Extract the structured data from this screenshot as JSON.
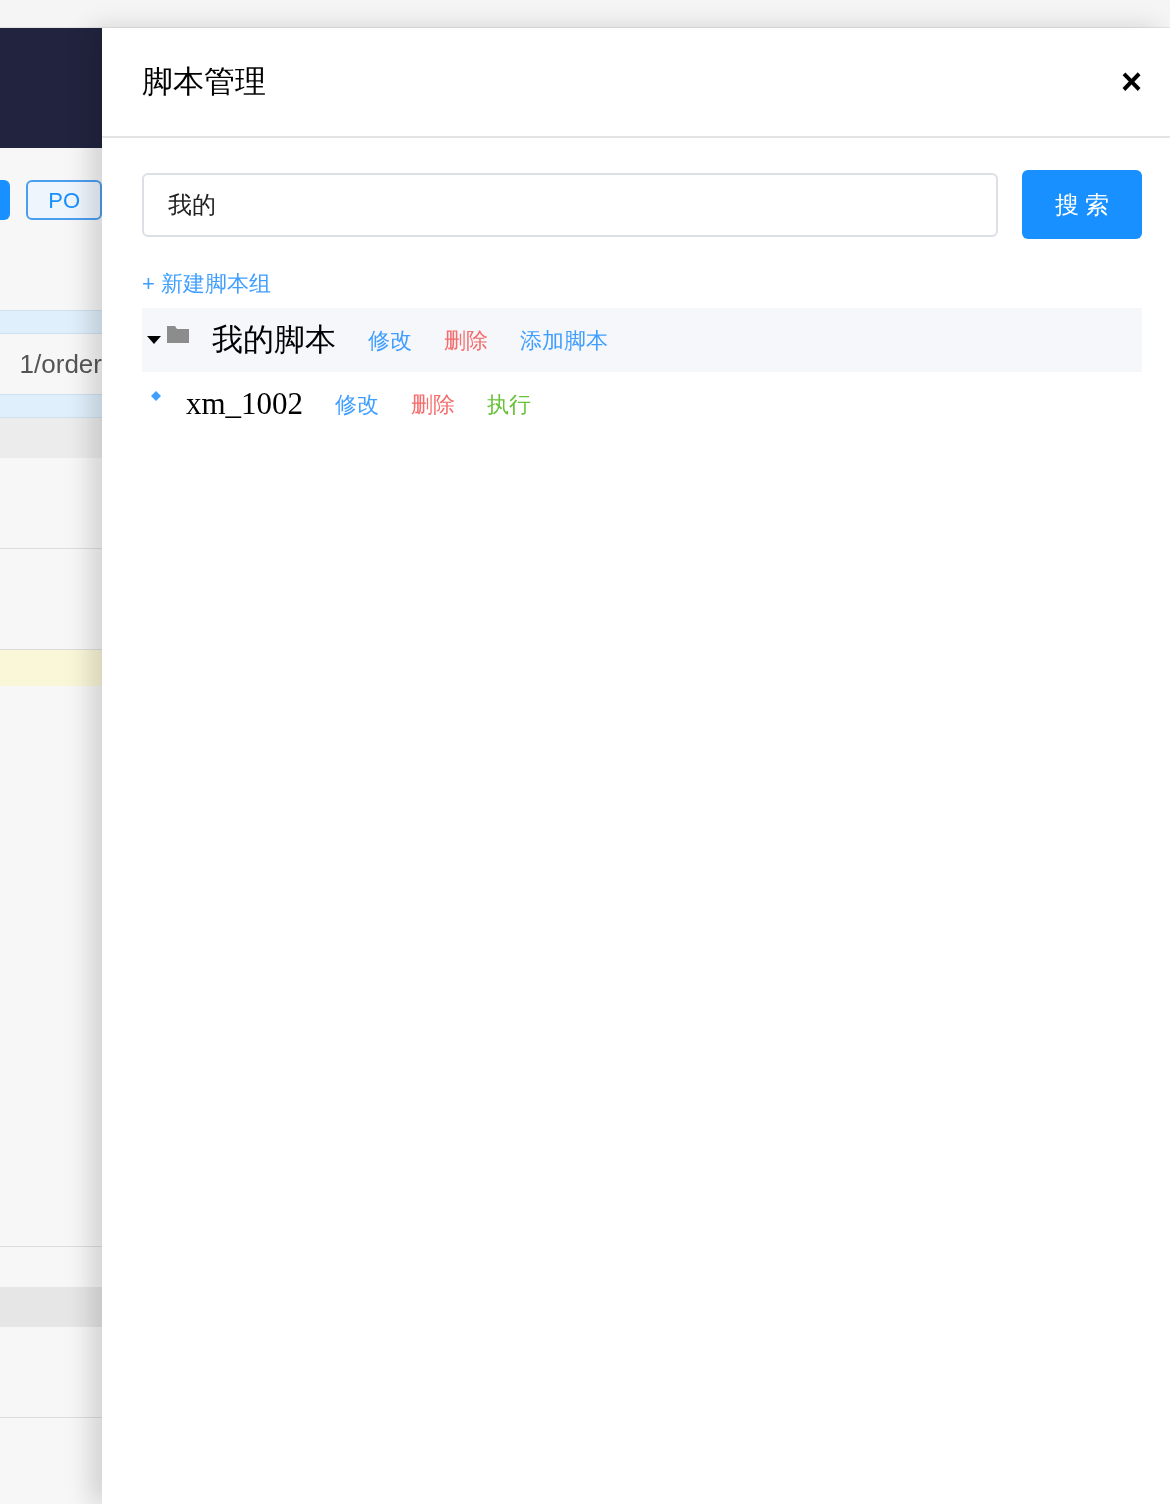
{
  "background": {
    "tag": "PO",
    "path": "1/order"
  },
  "drawer": {
    "title": "脚本管理",
    "close": "×",
    "search": {
      "value": "我的",
      "button": "搜 索"
    },
    "new_group": "+ 新建脚本组",
    "tree": [
      {
        "label": "我的脚本",
        "expanded": true,
        "actions": [
          {
            "label": "修改",
            "kind": "edit"
          },
          {
            "label": "删除",
            "kind": "delete"
          },
          {
            "label": "添加脚本",
            "kind": "add"
          }
        ],
        "children": [
          {
            "label": "xm_1002",
            "actions": [
              {
                "label": "修改",
                "kind": "edit"
              },
              {
                "label": "删除",
                "kind": "delete"
              },
              {
                "label": "执行",
                "kind": "run"
              }
            ]
          }
        ]
      }
    ]
  }
}
